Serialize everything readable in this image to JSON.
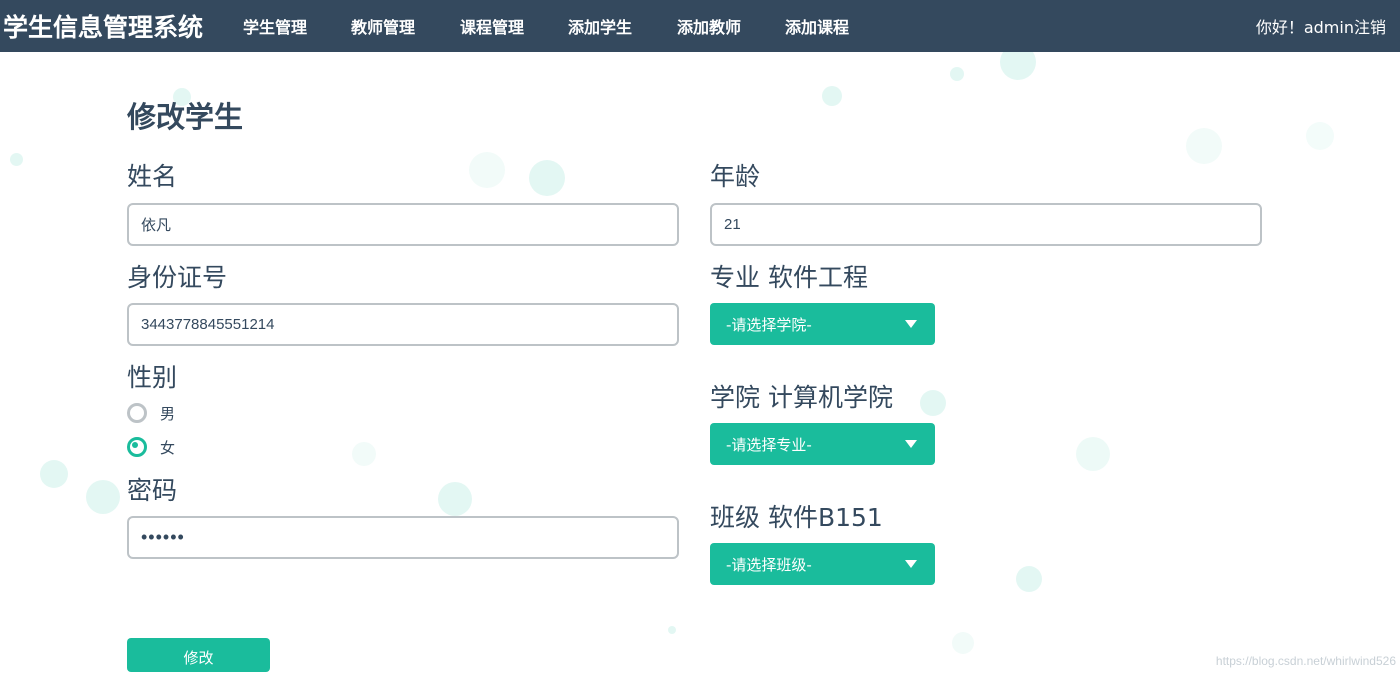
{
  "navbar": {
    "brand": "学生信息管理系统",
    "items": [
      "学生管理",
      "教师管理",
      "课程管理",
      "添加学生",
      "添加教师",
      "添加课程"
    ],
    "greeting": "你好！admin",
    "logout": "注销",
    "background": "#34495e"
  },
  "form": {
    "title": "修改学生",
    "name": {
      "label": "姓名",
      "value": "依凡"
    },
    "age": {
      "label": "年龄",
      "value": "21"
    },
    "id_number": {
      "label": "身份证号",
      "value": "3443778845551214"
    },
    "major": {
      "label": "专业 软件工程",
      "select_text": "-请选择学院-"
    },
    "gender": {
      "label": "性别",
      "options": [
        {
          "label": "男",
          "checked": false
        },
        {
          "label": "女",
          "checked": true
        }
      ]
    },
    "college": {
      "label": "学院 计算机学院",
      "select_text": "-请选择专业-"
    },
    "password": {
      "label": "密码",
      "value": "••••••"
    },
    "class": {
      "label": "班级 软件B151",
      "select_text": "-请选择班级-"
    },
    "submit_label": "修改"
  },
  "watermark": "https://blog.csdn.net/whirlwind526",
  "colors": {
    "accent": "#1abc9c",
    "text": "#34495e",
    "border": "#bdc3c7"
  },
  "icons": {
    "select_caret": "chevron-down-icon",
    "radio": "radio-icon"
  }
}
